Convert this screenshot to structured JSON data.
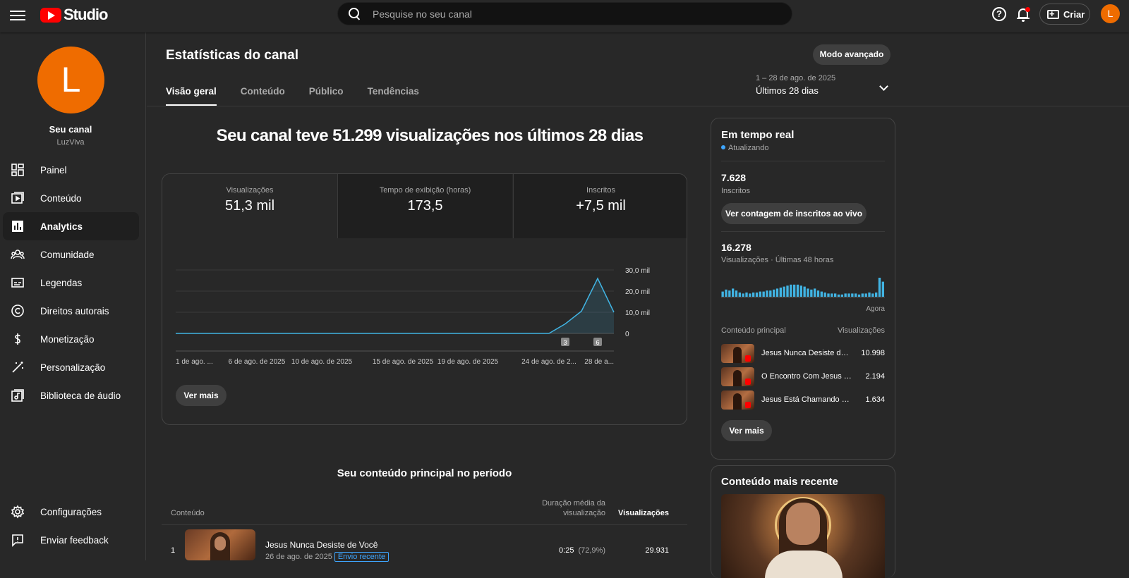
{
  "topbar": {
    "logo_text": "Studio",
    "search_placeholder": "Pesquise no seu canal",
    "help_glyph": "?",
    "create_label": "Criar",
    "avatar_letter": "L"
  },
  "sidebar": {
    "avatar_letter": "L",
    "channel_title": "Seu canal",
    "channel_handle": "LuzViva",
    "items": [
      {
        "label": "Painel",
        "icon": "dashboard-icon"
      },
      {
        "label": "Conteúdo",
        "icon": "content-icon"
      },
      {
        "label": "Analytics",
        "icon": "analytics-icon",
        "active": true
      },
      {
        "label": "Comunidade",
        "icon": "community-icon"
      },
      {
        "label": "Legendas",
        "icon": "subtitles-icon"
      },
      {
        "label": "Direitos autorais",
        "icon": "copyright-icon"
      },
      {
        "label": "Monetização",
        "icon": "money-icon"
      },
      {
        "label": "Personalização",
        "icon": "magic-wand-icon"
      },
      {
        "label": "Biblioteca de áudio",
        "icon": "audio-library-icon"
      }
    ],
    "bottom": [
      {
        "label": "Configurações",
        "icon": "gear-icon"
      },
      {
        "label": "Enviar feedback",
        "icon": "feedback-icon"
      }
    ]
  },
  "page": {
    "title": "Estatísticas do canal",
    "advanced_button": "Modo avançado",
    "tabs": [
      "Visão geral",
      "Conteúdo",
      "Público",
      "Tendências"
    ],
    "date_sub": "1 – 28 de ago. de 2025",
    "date_main": "Últimos 28 dias",
    "headline": "Seu canal teve 51.299 visualizações nos últimos 28 dias"
  },
  "metrics": [
    {
      "label": "Visualizações",
      "value": "51,3 mil"
    },
    {
      "label": "Tempo de exibição (horas)",
      "value": "173,5"
    },
    {
      "label": "Inscritos",
      "value": "+7,5 mil"
    }
  ],
  "chart_data": {
    "type": "area",
    "x": [
      "1 de ago.",
      "2",
      "3",
      "4",
      "5",
      "6",
      "7",
      "8",
      "9",
      "10",
      "11",
      "12",
      "13",
      "14",
      "15",
      "16",
      "17",
      "18",
      "19",
      "20",
      "21",
      "22",
      "23",
      "24",
      "25",
      "26",
      "27",
      "28"
    ],
    "values": [
      0,
      0,
      0,
      0,
      0,
      0,
      0,
      0,
      0,
      0,
      0,
      0,
      0,
      0,
      0,
      0,
      0,
      0,
      0,
      0,
      0,
      0,
      0,
      0,
      4500,
      10500,
      26000,
      10000
    ],
    "y_tick_labels": [
      "0",
      "10,0 mil",
      "20,0 mil",
      "30,0 mil"
    ],
    "ylim": [
      0,
      30000
    ],
    "x_tick_labels": [
      "1 de ago. ...",
      "6 de ago. de 2025",
      "10 de ago. de 2025",
      "15 de ago. de 2025",
      "19 de ago. de 2025",
      "24 de ago. de 2...",
      "28 de a..."
    ],
    "markers": [
      "3",
      "6"
    ],
    "series_color": "#41b4e3",
    "grid": true
  },
  "chart_more": "Ver mais",
  "top_content": {
    "title": "Seu conteúdo principal no período",
    "col_content": "Conteúdo",
    "col_duration": "Duração média da visualização",
    "col_views": "Visualizações",
    "rows": [
      {
        "index": "1",
        "title": "Jesus Nunca Desiste de Você",
        "date": "26 de ago. de 2025",
        "badge": "Envio recente",
        "duration": "0:25",
        "duration_pct": "(72,9%)",
        "views": "29.931"
      }
    ]
  },
  "realtime": {
    "title": "Em tempo real",
    "status": "Atualizando",
    "subscribers_value": "7.628",
    "subscribers_label": "Inscritos",
    "live_button": "Ver contagem de inscritos ao vivo",
    "views_value": "16.278",
    "views_label": "Visualizações · Últimas 48 horas",
    "bars": [
      6,
      8,
      7,
      9,
      7,
      5,
      4,
      5,
      4,
      5,
      5,
      6,
      6,
      7,
      7,
      8,
      9,
      10,
      11,
      12,
      13,
      13,
      13,
      12,
      11,
      9,
      8,
      9,
      7,
      6,
      5,
      4,
      4,
      4,
      3,
      3,
      4,
      4,
      4,
      4,
      3,
      4,
      4,
      5,
      4,
      5,
      20,
      16
    ],
    "now_label": "Agora",
    "col_content": "Conteúdo principal",
    "col_views": "Visualizações",
    "rows": [
      {
        "title": "Jesus Nunca Desiste de Você",
        "views": "10.998"
      },
      {
        "title": "O Encontro Com Jesus Que...",
        "views": "2.194"
      },
      {
        "title": "Jesus Está Chamando Você",
        "views": "1.634"
      }
    ],
    "more": "Ver mais"
  },
  "recent": {
    "title": "Conteúdo mais recente"
  }
}
